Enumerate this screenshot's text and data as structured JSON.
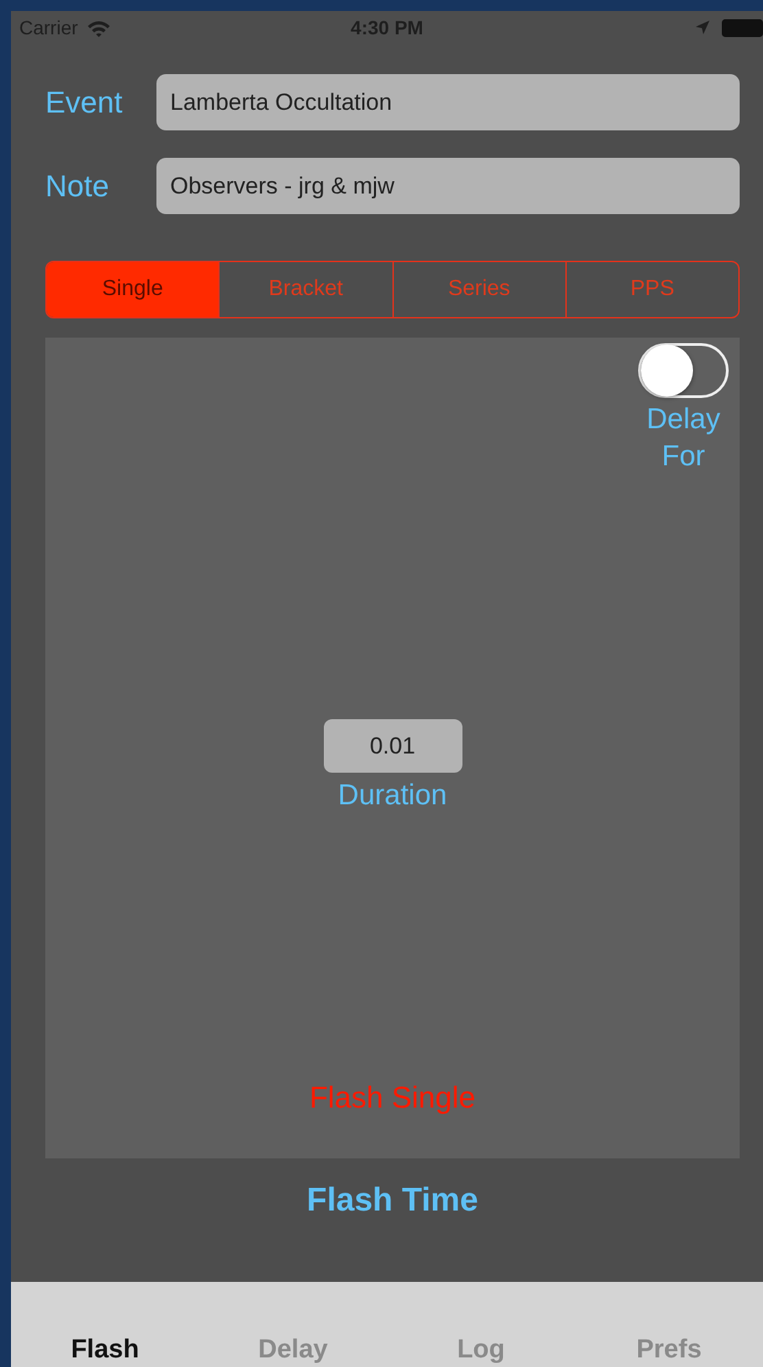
{
  "status_bar": {
    "carrier": "Carrier",
    "time": "4:30 PM"
  },
  "fields": [
    {
      "label": "Event",
      "value": "Lamberta Occultation"
    },
    {
      "label": "Note",
      "value": "Observers - jrg & mjw"
    }
  ],
  "modes": [
    {
      "label": "Single",
      "selected": true
    },
    {
      "label": "Bracket",
      "selected": false
    },
    {
      "label": "Series",
      "selected": false
    },
    {
      "label": "PPS",
      "selected": false
    }
  ],
  "delay_switch": {
    "label": "Delay For",
    "on": false
  },
  "duration": {
    "value": "0.01",
    "label": "Duration"
  },
  "flash_button": "Flash Single",
  "flash_time": "Flash Time",
  "tab_bar": [
    {
      "label": "Flash",
      "selected": true
    },
    {
      "label": "Delay",
      "selected": false
    },
    {
      "label": "Log",
      "selected": false
    },
    {
      "label": "Prefs",
      "selected": false
    }
  ]
}
